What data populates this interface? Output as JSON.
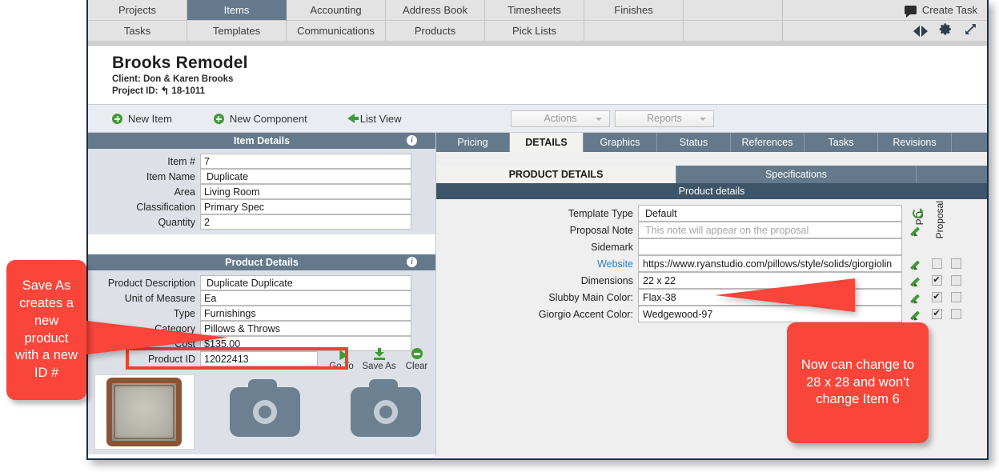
{
  "nav": {
    "row1": [
      {
        "label": "Projects",
        "active": false
      },
      {
        "label": "Items",
        "active": true
      },
      {
        "label": "Accounting",
        "active": false
      },
      {
        "label": "Address Book",
        "active": false
      },
      {
        "label": "Timesheets",
        "active": false
      },
      {
        "label": "Finishes",
        "active": false
      },
      {
        "label": "",
        "active": false
      }
    ],
    "row2": [
      {
        "label": "Tasks",
        "active": false
      },
      {
        "label": "Templates",
        "active": false
      },
      {
        "label": "Communications",
        "active": false
      },
      {
        "label": "Products",
        "active": false
      },
      {
        "label": "Pick Lists",
        "active": false
      },
      {
        "label": "",
        "active": false
      },
      {
        "label": "",
        "active": false
      }
    ],
    "create_task_label": "Create Task"
  },
  "project": {
    "title": "Brooks Remodel",
    "client_line": "Client: Don & Karen Brooks",
    "project_id_label": "Project ID:",
    "project_id_value": "18-1011"
  },
  "toolbar": {
    "new_item": "New Item",
    "new_component": "New Component",
    "list_view": "List View",
    "actions": "Actions",
    "reports": "Reports"
  },
  "item_details": {
    "title": "Item Details",
    "fields": [
      {
        "label": "Item #",
        "value": "7"
      },
      {
        "label": "Item Name",
        "value": "Duplicate"
      },
      {
        "label": "Area",
        "value": "Living Room"
      },
      {
        "label": "Classification",
        "value": "Primary Spec"
      },
      {
        "label": "Quantity",
        "value": "2"
      }
    ]
  },
  "product_details_left": {
    "title": "Product Details",
    "fields": [
      {
        "label": "Product Description",
        "value": "Duplicate Duplicate"
      },
      {
        "label": "Unit of Measure",
        "value": "Ea"
      },
      {
        "label": "Type",
        "value": "Furnishings"
      },
      {
        "label": "Category",
        "value": "Pillows & Throws"
      },
      {
        "label": "Cost",
        "value": "$135.00"
      }
    ],
    "product_id_label": "Product ID",
    "product_id_value": "12022413",
    "actions": [
      {
        "label": "Go To",
        "icon": "go-to-arrow-icon"
      },
      {
        "label": "Save As",
        "icon": "save-download-icon"
      },
      {
        "label": "Clear",
        "icon": "clear-minus-icon"
      }
    ]
  },
  "right_panel": {
    "tabs": [
      {
        "label": "Pricing",
        "active": false
      },
      {
        "label": "DETAILS",
        "active": true
      },
      {
        "label": "Graphics",
        "active": false
      },
      {
        "label": "Status",
        "active": false
      },
      {
        "label": "References",
        "active": false
      },
      {
        "label": "Tasks",
        "active": false
      },
      {
        "label": "Revisions",
        "active": false
      }
    ],
    "subtabs": [
      {
        "label": "PRODUCT DETAILS",
        "active": true
      },
      {
        "label": "Specifications",
        "active": false
      }
    ],
    "section_title": "Product details",
    "col_header_po": "PO",
    "col_header_proposal": "Proposal",
    "rows": [
      {
        "label": "Template Type",
        "value": "Default",
        "placeholder": false,
        "link": false,
        "po": null,
        "proposal": null
      },
      {
        "label": "Proposal Note",
        "value": "This note will appear on the proposal",
        "placeholder": true,
        "link": false,
        "po": null,
        "proposal": null
      },
      {
        "label": "Sidemark",
        "value": "",
        "placeholder": false,
        "link": false,
        "po": null,
        "proposal": null
      },
      {
        "label": "Website",
        "value": "https://www.ryanstudio.com/pillows/style/solids/giorgiolin",
        "placeholder": false,
        "link": true,
        "po": false,
        "proposal": false
      },
      {
        "label": "Dimensions",
        "value": "22 x 22",
        "placeholder": false,
        "link": false,
        "po": true,
        "proposal": false
      },
      {
        "label": "Slubby Main Color:",
        "value": "Flax-38",
        "placeholder": false,
        "link": false,
        "po": true,
        "proposal": false
      },
      {
        "label": "Giorgio Accent Color:",
        "value": "Wedgewood-97",
        "placeholder": false,
        "link": false,
        "po": true,
        "proposal": false
      }
    ]
  },
  "callouts": {
    "left": "Save As creates a new product with a new ID #",
    "right": "Now can change to 28 x 28 and won't change Item 6"
  },
  "colors": {
    "accent_red": "#f9453a",
    "header_slate": "#64798c",
    "header_slate_dark": "#3e5468",
    "green": "#3f9b35",
    "link_blue": "#2f7fc1"
  }
}
